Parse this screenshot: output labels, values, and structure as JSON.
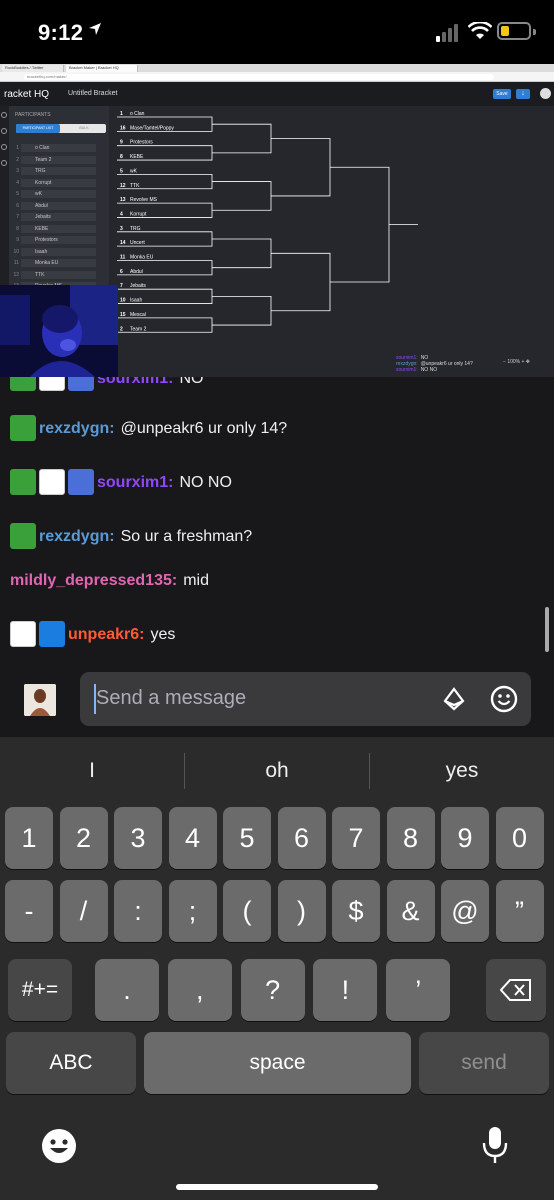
{
  "status": {
    "time": "9:12"
  },
  "browser": {
    "tabs": [
      "RockBuddies / Twitter",
      "Bracket Maker | Bracket HQ"
    ],
    "url": "brackethq.com/maker/"
  },
  "app": {
    "logo": "racket HQ",
    "title": "Untitled Bracket",
    "save_label": "Save",
    "participants_header": "PARTICIPANTS",
    "tab_list": "PARTICIPANT LIST",
    "tab_bulk": "BULK",
    "participants": [
      {
        "n": "1",
        "name": "o Clan"
      },
      {
        "n": "2",
        "name": "Team 2"
      },
      {
        "n": "3",
        "name": "TRG"
      },
      {
        "n": "4",
        "name": "Korrupt"
      },
      {
        "n": "5",
        "name": "wK"
      },
      {
        "n": "6",
        "name": "Abdul"
      },
      {
        "n": "7",
        "name": "Jebaits"
      },
      {
        "n": "8",
        "name": "KEBE"
      },
      {
        "n": "9",
        "name": "Protestors"
      },
      {
        "n": "10",
        "name": "Isaah"
      },
      {
        "n": "11",
        "name": "Monka EU"
      },
      {
        "n": "12",
        "name": "TTK"
      },
      {
        "n": "13",
        "name": "Revolve MS"
      }
    ],
    "bracket": [
      {
        "seed": "1",
        "name": "o Clan"
      },
      {
        "seed": "16",
        "name": "Mase/Tamtel/Poppy"
      },
      {
        "seed": "9",
        "name": "Protestors"
      },
      {
        "seed": "8",
        "name": "KEBE"
      },
      {
        "seed": "5",
        "name": "wK"
      },
      {
        "seed": "12",
        "name": "TTK"
      },
      {
        "seed": "13",
        "name": "Revolve MS"
      },
      {
        "seed": "4",
        "name": "Korrupt"
      },
      {
        "seed": "3",
        "name": "TRG"
      },
      {
        "seed": "14",
        "name": "Uncert"
      },
      {
        "seed": "11",
        "name": "Monka EU"
      },
      {
        "seed": "6",
        "name": "Abdul"
      },
      {
        "seed": "7",
        "name": "Jebaits"
      },
      {
        "seed": "10",
        "name": "Isaah"
      },
      {
        "seed": "15",
        "name": "Mescal"
      },
      {
        "seed": "2",
        "name": "Team 2"
      }
    ],
    "zoom": "100%",
    "mini_chat": [
      {
        "user": "sourxim1:",
        "text": "NO"
      },
      {
        "user": "rexzdygn:",
        "text": "@unpeakr6 ur only 14?"
      },
      {
        "user": "sourxim1:",
        "text": "NO NO"
      }
    ]
  },
  "chat": {
    "messages": [
      {
        "user": "sourxim1:",
        "text": "NO",
        "color": "#9147ff"
      },
      {
        "user": "rexzdygn:",
        "text": "@unpeakr6 ur only 14?",
        "color": "#5b9bd5"
      },
      {
        "user": "sourxim1:",
        "text": "NO NO",
        "color": "#9147ff"
      },
      {
        "user": "rexzdygn:",
        "text": "So ur a freshman?",
        "color": "#5b9bd5"
      },
      {
        "user": "mildly_depressed135:",
        "text": "mid",
        "color": "#e066b3"
      },
      {
        "user": "unpeakr6:",
        "text": "yes",
        "color": "#ff5a36"
      }
    ],
    "input_placeholder": "Send a message"
  },
  "keyboard": {
    "suggestions": [
      "I",
      "oh",
      "yes"
    ],
    "row1": [
      "1",
      "2",
      "3",
      "4",
      "5",
      "6",
      "7",
      "8",
      "9",
      "0"
    ],
    "row2": [
      "-",
      "/",
      ":",
      ";",
      "(",
      ")",
      "$",
      "&",
      "@",
      "”"
    ],
    "row3_left": "#+=",
    "row3": [
      ".",
      ",",
      "?",
      "!",
      "’"
    ],
    "abc": "ABC",
    "space": "space",
    "send": "send"
  }
}
